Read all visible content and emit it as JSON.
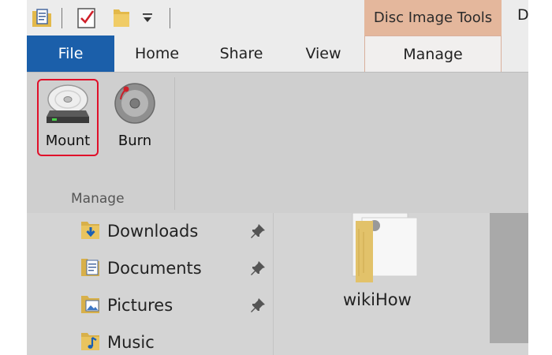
{
  "quick_access": {
    "icons": [
      "properties-icon",
      "checkbox-icon",
      "folder-icon",
      "customize-dropdown-icon"
    ]
  },
  "contextual_tab": {
    "header": "Disc Image Tools",
    "truncated_title": "D"
  },
  "tabs": {
    "file": "File",
    "home": "Home",
    "share": "Share",
    "view": "View",
    "manage": "Manage"
  },
  "ribbon": {
    "mount_label": "Mount",
    "burn_label": "Burn",
    "group_label": "Manage"
  },
  "nav_pane": {
    "items": [
      {
        "label": "Downloads",
        "icon": "downloads-folder-icon",
        "pinned": true
      },
      {
        "label": "Documents",
        "icon": "documents-folder-icon",
        "pinned": true
      },
      {
        "label": "Pictures",
        "icon": "pictures-folder-icon",
        "pinned": true
      },
      {
        "label": "Music",
        "icon": "music-folder-icon",
        "pinned": false
      }
    ]
  },
  "files": {
    "items": [
      {
        "label": "wikiHow",
        "icon": "folder-with-documents-icon"
      }
    ]
  },
  "colors": {
    "file_tab": "#1b5faa",
    "contextual_header": "#e4b79c",
    "highlight_border": "#e0102a"
  }
}
